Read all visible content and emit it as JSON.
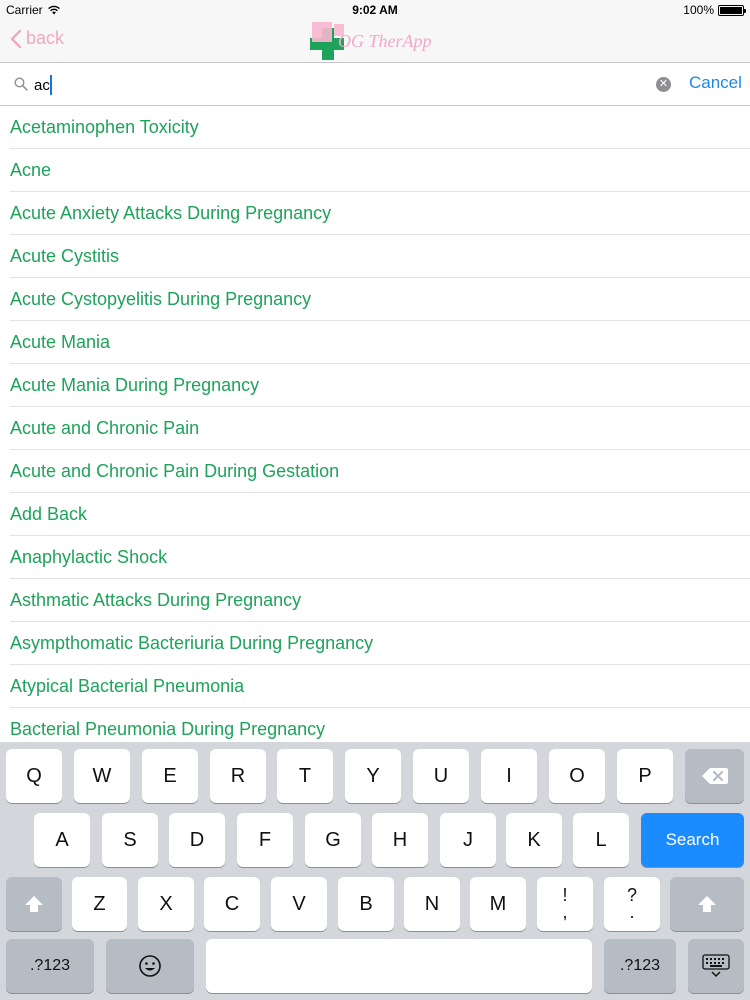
{
  "status_bar": {
    "carrier": "Carrier",
    "time": "9:02 AM",
    "battery": "100%"
  },
  "nav": {
    "back_label": "back",
    "logo_text": "OG TherApp"
  },
  "search": {
    "value": "ac",
    "cancel_label": "Cancel"
  },
  "results": [
    "Acetaminophen Toxicity",
    "Acne",
    "Acute Anxiety Attacks During Pregnancy",
    "Acute Cystitis",
    "Acute Cystopyelitis During Pregnancy",
    "Acute Mania",
    "Acute Mania During Pregnancy",
    "Acute and Chronic Pain",
    "Acute and Chronic Pain During Gestation",
    "Add Back",
    "Anaphylactic Shock",
    "Asthmatic Attacks During Pregnancy",
    "Asympthomatic Bacteriuria During Pregnancy",
    "Atypical Bacterial Pneumonia",
    "Bacterial Pneumonia During Pregnancy"
  ],
  "keyboard": {
    "row1": [
      "Q",
      "W",
      "E",
      "R",
      "T",
      "Y",
      "U",
      "I",
      "O",
      "P"
    ],
    "row2": [
      "A",
      "S",
      "D",
      "F",
      "G",
      "H",
      "J",
      "K",
      "L"
    ],
    "row3": [
      "Z",
      "X",
      "C",
      "V",
      "B",
      "N",
      "M"
    ],
    "punct1": [
      "!",
      ","
    ],
    "punct2": [
      "?",
      "."
    ],
    "search_label": "Search",
    "numbers_label": ".?123"
  },
  "colors": {
    "list_text": "#1ea35a",
    "accent_blue": "#1a8cff",
    "back_pink": "#f0a8c4",
    "logo_pink": "#f2a7c6",
    "logo_green": "#1ea35a"
  }
}
